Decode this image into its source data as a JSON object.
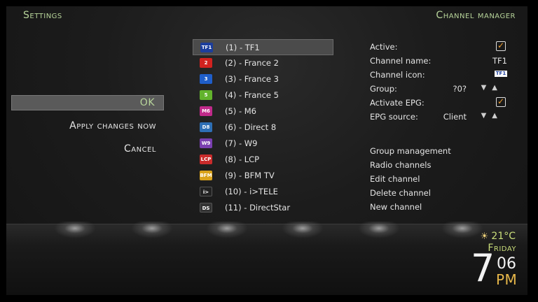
{
  "header": {
    "left_title": "Settings",
    "right_title": "Channel manager"
  },
  "menu": {
    "ok": "OK",
    "apply": "Apply changes now",
    "cancel": "Cancel"
  },
  "channels": [
    {
      "label": "(1) - TF1",
      "logo": "TF1",
      "color": "#1c3e9c"
    },
    {
      "label": "(2) - France 2",
      "logo": "2",
      "color": "#d1221f"
    },
    {
      "label": "(3) - France 3",
      "logo": "3",
      "color": "#1f5ec9"
    },
    {
      "label": "(4) - France 5",
      "logo": "5",
      "color": "#62b32c"
    },
    {
      "label": "(5) - M6",
      "logo": "M6",
      "color": "#c02a8a"
    },
    {
      "label": "(6) - Direct 8",
      "logo": "D8",
      "color": "#2e6fb5"
    },
    {
      "label": "(7) - W9",
      "logo": "W9",
      "color": "#7a3fb0"
    },
    {
      "label": "(8) - LCP",
      "logo": "LCP",
      "color": "#c92b2b"
    },
    {
      "label": "(9) - BFM TV",
      "logo": "BFM",
      "color": "#d9a21a"
    },
    {
      "label": "(10) - i>TELE",
      "logo": "i>",
      "color": "#222222"
    },
    {
      "label": "(11) - DirectStar",
      "logo": "DS",
      "color": "#333333"
    }
  ],
  "properties": {
    "active": {
      "label": "Active:"
    },
    "channel_name": {
      "label": "Channel name:",
      "value": "TF1"
    },
    "channel_icon": {
      "label": "Channel icon:",
      "icon_text": "TF1"
    },
    "group": {
      "label": "Group:",
      "value": "?0?"
    },
    "activate_epg": {
      "label": "Activate EPG:"
    },
    "epg_source": {
      "label": "EPG source:",
      "value": "Client"
    }
  },
  "actions": {
    "group_management": "Group management",
    "radio_channels": "Radio channels",
    "edit_channel": "Edit channel",
    "delete_channel": "Delete channel",
    "new_channel": "New channel"
  },
  "status": {
    "temperature": "21°C",
    "day": "Friday",
    "hour": "7",
    "minute": "06",
    "ampm": "PM"
  },
  "colors": {
    "accent_green": "#b7d49a",
    "check_orange": "#f0a030",
    "ampm_gold": "#e8b84a"
  }
}
